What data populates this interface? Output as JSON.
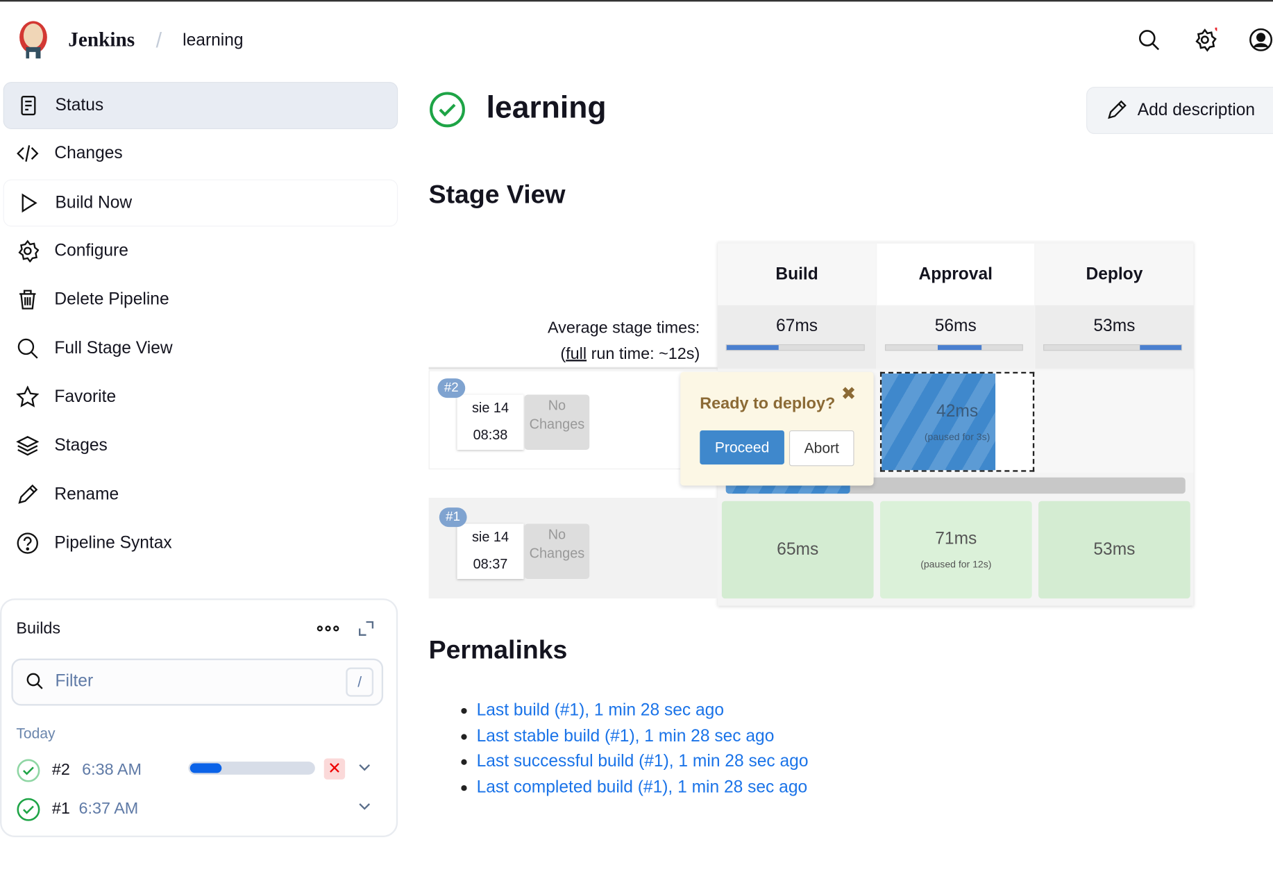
{
  "header": {
    "brand": "Jenkins",
    "separator": "/",
    "breadcrumb": "learning"
  },
  "sidebar": {
    "items": [
      {
        "label": "Status",
        "icon": "document-icon"
      },
      {
        "label": "Changes",
        "icon": "code-icon"
      },
      {
        "label": "Build Now",
        "icon": "play-icon"
      },
      {
        "label": "Configure",
        "icon": "gear-icon"
      },
      {
        "label": "Delete Pipeline",
        "icon": "trash-icon"
      },
      {
        "label": "Full Stage View",
        "icon": "search-icon"
      },
      {
        "label": "Favorite",
        "icon": "star-icon"
      },
      {
        "label": "Stages",
        "icon": "layers-icon"
      },
      {
        "label": "Rename",
        "icon": "pencil-icon"
      },
      {
        "label": "Pipeline Syntax",
        "icon": "help-icon"
      }
    ]
  },
  "builds": {
    "title": "Builds",
    "filter_placeholder": "Filter",
    "shortcut": "/",
    "group": "Today",
    "items": [
      {
        "number": "#2",
        "time": "6:38 AM",
        "progress": 0.25,
        "running": true
      },
      {
        "number": "#1",
        "time": "6:37 AM",
        "running": false
      }
    ]
  },
  "main": {
    "title": "learning",
    "add_description": "Add description",
    "stage_view_title": "Stage View",
    "avg_label": "Average stage times:",
    "full_prefix": "(",
    "full_link": "full",
    "full_suffix": " run time: ~12s)",
    "stages": [
      {
        "name": "Build",
        "avg": "67ms"
      },
      {
        "name": "Approval",
        "avg": "56ms"
      },
      {
        "name": "Deploy",
        "avg": "53ms"
      }
    ],
    "runs": [
      {
        "badge": "#2",
        "date": "sie 14",
        "time": "08:38",
        "changes_line1": "No",
        "changes_line2": "Changes",
        "cells": [
          "",
          "42ms",
          ""
        ],
        "approval_note": "(paused for 3s)"
      },
      {
        "badge": "#1",
        "date": "sie 14",
        "time": "08:37",
        "changes_line1": "No",
        "changes_line2": "Changes",
        "cells": [
          "65ms",
          "71ms",
          "53ms"
        ],
        "approval_note": "(paused for 12s)"
      }
    ],
    "popup": {
      "question": "Ready to deploy?",
      "proceed": "Proceed",
      "abort": "Abort"
    },
    "permalinks_title": "Permalinks",
    "permalinks": [
      "Last build (#1), 1 min 28 sec ago",
      "Last stable build (#1), 1 min 28 sec ago",
      "Last successful build (#1), 1 min 28 sec ago",
      "Last completed build (#1), 1 min 28 sec ago"
    ]
  },
  "colors": {
    "success": "#1ea446",
    "link": "#1a73e8",
    "stage_blue": "#3f88cc",
    "stage_green": "#d4ecd2"
  }
}
